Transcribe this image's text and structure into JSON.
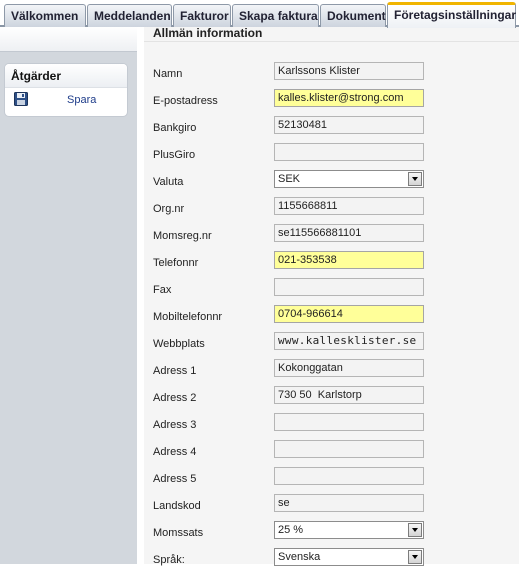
{
  "tabs": [
    {
      "label": "Välkommen"
    },
    {
      "label": "Meddelanden"
    },
    {
      "label": "Fakturor"
    },
    {
      "label": "Skapa faktura"
    },
    {
      "label": "Dokument"
    },
    {
      "label": "Företagsinställningar",
      "active": true
    }
  ],
  "sidebar": {
    "panel_title": "Åtgärder",
    "save_label": "Spara"
  },
  "form": {
    "title": "Allmän information",
    "fields": {
      "namn": {
        "label": "Namn",
        "value": "Karlssons Klister"
      },
      "epost": {
        "label": "E-postadress",
        "value": "kalles.klister@strong.com"
      },
      "bankgiro": {
        "label": "Bankgiro",
        "value": "52130481"
      },
      "plusgiro": {
        "label": "PlusGiro",
        "value": ""
      },
      "valuta": {
        "label": "Valuta",
        "value": "SEK"
      },
      "orgnr": {
        "label": "Org.nr",
        "value": "1155668811"
      },
      "momsreg": {
        "label": "Momsreg.nr",
        "value": "se115566881101"
      },
      "telefon": {
        "label": "Telefonnr",
        "value": "021-353538"
      },
      "fax": {
        "label": "Fax",
        "value": ""
      },
      "mobil": {
        "label": "Mobiltelefonnr",
        "value": "0704-966614"
      },
      "webb": {
        "label": "Webbplats",
        "value": "www.kallesklister.se"
      },
      "adress1": {
        "label": "Adress 1",
        "value": "Kokonggatan"
      },
      "adress2": {
        "label": "Adress 2",
        "value": "730 50  Karlstorp"
      },
      "adress3": {
        "label": "Adress 3",
        "value": ""
      },
      "adress4": {
        "label": "Adress 4",
        "value": ""
      },
      "adress5": {
        "label": "Adress 5",
        "value": ""
      },
      "landskod": {
        "label": "Landskod",
        "value": "se"
      },
      "momssats": {
        "label": "Momssats",
        "value": "25 %"
      },
      "sprak": {
        "label": "Språk:",
        "value": "Svenska"
      }
    }
  }
}
